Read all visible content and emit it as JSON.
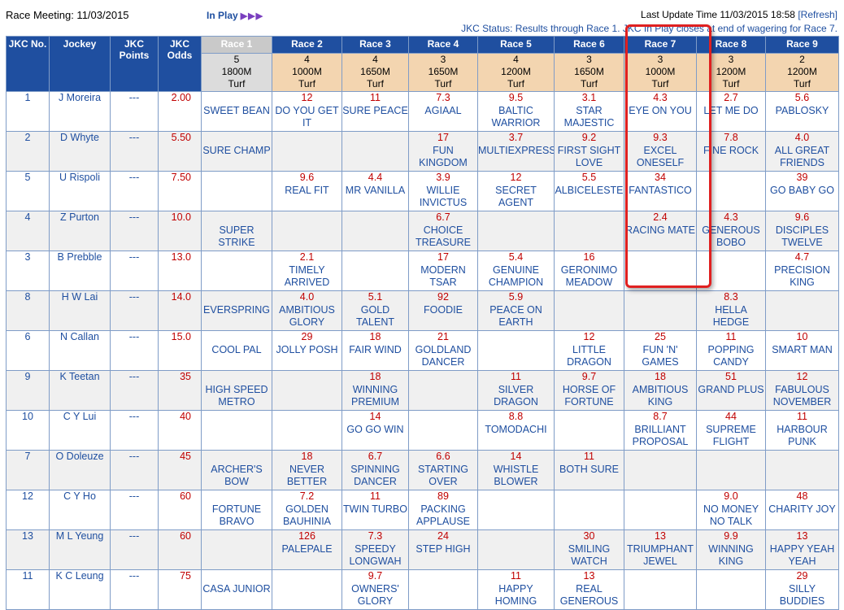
{
  "header": {
    "meeting_label": "Race Meeting: 11/03/2015",
    "inplay_label": "In Play",
    "inplay_arrows": "▶▶▶",
    "last_update_prefix": "Last Update Time 11/03/2015 18:58",
    "refresh_label": "[Refresh]",
    "jkc_status": "JKC Status: Results through Race 1. JKC In Play closes at end of wagering for Race 7."
  },
  "columns": {
    "jkc_no": "JKC No.",
    "jockey": "Jockey",
    "jkc_points": "JKC Points",
    "jkc_odds": "JKC Odds"
  },
  "races": [
    {
      "label": "Race 1",
      "runners": "5",
      "distance": "1800M",
      "surface": "Turf",
      "completed": true
    },
    {
      "label": "Race 2",
      "runners": "4",
      "distance": "1000M",
      "surface": "Turf",
      "completed": false
    },
    {
      "label": "Race 3",
      "runners": "4",
      "distance": "1650M",
      "surface": "Turf",
      "completed": false
    },
    {
      "label": "Race 4",
      "runners": "3",
      "distance": "1650M",
      "surface": "Turf",
      "completed": false
    },
    {
      "label": "Race 5",
      "runners": "4",
      "distance": "1200M",
      "surface": "Turf",
      "completed": false
    },
    {
      "label": "Race 6",
      "runners": "3",
      "distance": "1650M",
      "surface": "Turf",
      "completed": false
    },
    {
      "label": "Race 7",
      "runners": "3",
      "distance": "1000M",
      "surface": "Turf",
      "completed": false
    },
    {
      "label": "Race 8",
      "runners": "3",
      "distance": "1200M",
      "surface": "Turf",
      "completed": false
    },
    {
      "label": "Race 9",
      "runners": "2",
      "distance": "1200M",
      "surface": "Turf",
      "completed": false
    }
  ],
  "rows": [
    {
      "no": "1",
      "jockey": "J Moreira",
      "points": "---",
      "odds": "2.00",
      "cells": [
        {
          "odds": "",
          "horse": "SWEET BEAN"
        },
        {
          "odds": "12",
          "horse": "DO YOU GET IT"
        },
        {
          "odds": "11",
          "horse": "SURE PEACE"
        },
        {
          "odds": "7.3",
          "horse": "AGIAAL"
        },
        {
          "odds": "9.5",
          "horse": "BALTIC WARRIOR"
        },
        {
          "odds": "3.1",
          "horse": "STAR MAJESTIC"
        },
        {
          "odds": "4.3",
          "horse": "EYE ON YOU"
        },
        {
          "odds": "2.7",
          "horse": "LET ME DO"
        },
        {
          "odds": "5.6",
          "horse": "PABLOSKY"
        }
      ]
    },
    {
      "no": "2",
      "jockey": "D Whyte",
      "points": "---",
      "odds": "5.50",
      "cells": [
        {
          "odds": "",
          "horse": "SURE CHAMP"
        },
        {
          "odds": "",
          "horse": ""
        },
        {
          "odds": "",
          "horse": ""
        },
        {
          "odds": "17",
          "horse": "FUN KINGDOM"
        },
        {
          "odds": "3.7",
          "horse": "MULTIEXPRESS"
        },
        {
          "odds": "9.2",
          "horse": "FIRST SIGHT LOVE"
        },
        {
          "odds": "9.3",
          "horse": "EXCEL ONESELF"
        },
        {
          "odds": "7.8",
          "horse": "FINE ROCK"
        },
        {
          "odds": "4.0",
          "horse": "ALL GREAT FRIENDS"
        }
      ]
    },
    {
      "no": "5",
      "jockey": "U Rispoli",
      "points": "---",
      "odds": "7.50",
      "cells": [
        {
          "odds": "",
          "horse": ""
        },
        {
          "odds": "9.6",
          "horse": "REAL FIT"
        },
        {
          "odds": "4.4",
          "horse": "MR VANILLA"
        },
        {
          "odds": "3.9",
          "horse": "WILLIE INVICTUS"
        },
        {
          "odds": "12",
          "horse": "SECRET AGENT"
        },
        {
          "odds": "5.5",
          "horse": "ALBICELESTE"
        },
        {
          "odds": "34",
          "horse": "FANTASTICO"
        },
        {
          "odds": "",
          "horse": ""
        },
        {
          "odds": "39",
          "horse": "GO BABY GO"
        }
      ]
    },
    {
      "no": "4",
      "jockey": "Z Purton",
      "points": "---",
      "odds": "10.0",
      "cells": [
        {
          "odds": "",
          "horse": "SUPER STRIKE"
        },
        {
          "odds": "",
          "horse": ""
        },
        {
          "odds": "",
          "horse": ""
        },
        {
          "odds": "6.7",
          "horse": "CHOICE TREASURE"
        },
        {
          "odds": "",
          "horse": ""
        },
        {
          "odds": "",
          "horse": ""
        },
        {
          "odds": "2.4",
          "horse": "RACING MATE"
        },
        {
          "odds": "4.3",
          "horse": "GENEROUS BOBO"
        },
        {
          "odds": "9.6",
          "horse": "DISCIPLES TWELVE"
        }
      ]
    },
    {
      "no": "3",
      "jockey": "B Prebble",
      "points": "---",
      "odds": "13.0",
      "cells": [
        {
          "odds": "",
          "horse": ""
        },
        {
          "odds": "2.1",
          "horse": "TIMELY ARRIVED"
        },
        {
          "odds": "",
          "horse": ""
        },
        {
          "odds": "17",
          "horse": "MODERN TSAR"
        },
        {
          "odds": "5.4",
          "horse": "GENUINE CHAMPION"
        },
        {
          "odds": "16",
          "horse": "GERONIMO MEADOW"
        },
        {
          "odds": "",
          "horse": ""
        },
        {
          "odds": "",
          "horse": ""
        },
        {
          "odds": "4.7",
          "horse": "PRECISION KING"
        }
      ]
    },
    {
      "no": "8",
      "jockey": "H W Lai",
      "points": "---",
      "odds": "14.0",
      "cells": [
        {
          "odds": "",
          "horse": "EVERSPRING"
        },
        {
          "odds": "4.0",
          "horse": "AMBITIOUS GLORY"
        },
        {
          "odds": "5.1",
          "horse": "GOLD TALENT"
        },
        {
          "odds": "92",
          "horse": "FOODIE"
        },
        {
          "odds": "5.9",
          "horse": "PEACE ON EARTH"
        },
        {
          "odds": "",
          "horse": ""
        },
        {
          "odds": "",
          "horse": ""
        },
        {
          "odds": "8.3",
          "horse": "HELLA HEDGE"
        },
        {
          "odds": "",
          "horse": ""
        }
      ]
    },
    {
      "no": "6",
      "jockey": "N Callan",
      "points": "---",
      "odds": "15.0",
      "cells": [
        {
          "odds": "",
          "horse": "COOL PAL"
        },
        {
          "odds": "29",
          "horse": "JOLLY POSH"
        },
        {
          "odds": "18",
          "horse": "FAIR WIND"
        },
        {
          "odds": "21",
          "horse": "GOLDLAND DANCER"
        },
        {
          "odds": "",
          "horse": ""
        },
        {
          "odds": "12",
          "horse": "LITTLE DRAGON"
        },
        {
          "odds": "25",
          "horse": "FUN 'N' GAMES"
        },
        {
          "odds": "11",
          "horse": "POPPING CANDY"
        },
        {
          "odds": "10",
          "horse": "SMART MAN"
        }
      ]
    },
    {
      "no": "9",
      "jockey": "K Teetan",
      "points": "---",
      "odds": "35",
      "cells": [
        {
          "odds": "",
          "horse": "HIGH SPEED METRO"
        },
        {
          "odds": "",
          "horse": ""
        },
        {
          "odds": "18",
          "horse": "WINNING PREMIUM"
        },
        {
          "odds": "",
          "horse": ""
        },
        {
          "odds": "11",
          "horse": "SILVER DRAGON"
        },
        {
          "odds": "9.7",
          "horse": "HORSE OF FORTUNE"
        },
        {
          "odds": "18",
          "horse": "AMBITIOUS KING"
        },
        {
          "odds": "51",
          "horse": "GRAND PLUS"
        },
        {
          "odds": "12",
          "horse": "FABULOUS NOVEMBER"
        }
      ]
    },
    {
      "no": "10",
      "jockey": "C Y Lui",
      "points": "---",
      "odds": "40",
      "cells": [
        {
          "odds": "",
          "horse": ""
        },
        {
          "odds": "",
          "horse": ""
        },
        {
          "odds": "14",
          "horse": "GO GO WIN"
        },
        {
          "odds": "",
          "horse": ""
        },
        {
          "odds": "8.8",
          "horse": "TOMODACHI"
        },
        {
          "odds": "",
          "horse": ""
        },
        {
          "odds": "8.7",
          "horse": "BRILLIANT PROPOSAL"
        },
        {
          "odds": "44",
          "horse": "SUPREME FLIGHT"
        },
        {
          "odds": "11",
          "horse": "HARBOUR PUNK"
        }
      ]
    },
    {
      "no": "7",
      "jockey": "O Doleuze",
      "points": "---",
      "odds": "45",
      "cells": [
        {
          "odds": "",
          "horse": "ARCHER'S BOW"
        },
        {
          "odds": "18",
          "horse": "NEVER BETTER"
        },
        {
          "odds": "6.7",
          "horse": "SPINNING DANCER"
        },
        {
          "odds": "6.6",
          "horse": "STARTING OVER"
        },
        {
          "odds": "14",
          "horse": "WHISTLE BLOWER"
        },
        {
          "odds": "11",
          "horse": "BOTH SURE"
        },
        {
          "odds": "",
          "horse": ""
        },
        {
          "odds": "",
          "horse": ""
        },
        {
          "odds": "",
          "horse": ""
        }
      ]
    },
    {
      "no": "12",
      "jockey": "C Y Ho",
      "points": "---",
      "odds": "60",
      "cells": [
        {
          "odds": "",
          "horse": "FORTUNE BRAVO"
        },
        {
          "odds": "7.2",
          "horse": "GOLDEN BAUHINIA"
        },
        {
          "odds": "11",
          "horse": "TWIN TURBO"
        },
        {
          "odds": "89",
          "horse": "PACKING APPLAUSE"
        },
        {
          "odds": "",
          "horse": ""
        },
        {
          "odds": "",
          "horse": ""
        },
        {
          "odds": "",
          "horse": ""
        },
        {
          "odds": "9.0",
          "horse": "NO MONEY NO TALK"
        },
        {
          "odds": "48",
          "horse": "CHARITY JOY"
        }
      ]
    },
    {
      "no": "13",
      "jockey": "M L Yeung",
      "points": "---",
      "odds": "60",
      "cells": [
        {
          "odds": "",
          "horse": ""
        },
        {
          "odds": "126",
          "horse": "PALEPALE"
        },
        {
          "odds": "7.3",
          "horse": "SPEEDY LONGWAH"
        },
        {
          "odds": "24",
          "horse": "STEP HIGH"
        },
        {
          "odds": "",
          "horse": ""
        },
        {
          "odds": "30",
          "horse": "SMILING WATCH"
        },
        {
          "odds": "13",
          "horse": "TRIUMPHANT JEWEL"
        },
        {
          "odds": "9.9",
          "horse": "WINNING KING"
        },
        {
          "odds": "13",
          "horse": "HAPPY YEAH YEAH"
        }
      ]
    },
    {
      "no": "11",
      "jockey": "K C Leung",
      "points": "---",
      "odds": "75",
      "cells": [
        {
          "odds": "",
          "horse": "CASA JUNIOR"
        },
        {
          "odds": "",
          "horse": ""
        },
        {
          "odds": "9.7",
          "horse": "OWNERS' GLORY"
        },
        {
          "odds": "",
          "horse": ""
        },
        {
          "odds": "11",
          "horse": "HAPPY HOMING"
        },
        {
          "odds": "13",
          "horse": "REAL GENEROUS"
        },
        {
          "odds": "",
          "horse": ""
        },
        {
          "odds": "",
          "horse": ""
        },
        {
          "odds": "29",
          "horse": "SILLY BUDDIES"
        }
      ]
    }
  ],
  "colors": {
    "header_blue": "#1f4fa0",
    "odds_red": "#c00000",
    "race_info_bg": "#f3d5b0",
    "completed_bg": "#c9c9c9",
    "highlight_red": "#e02020"
  }
}
